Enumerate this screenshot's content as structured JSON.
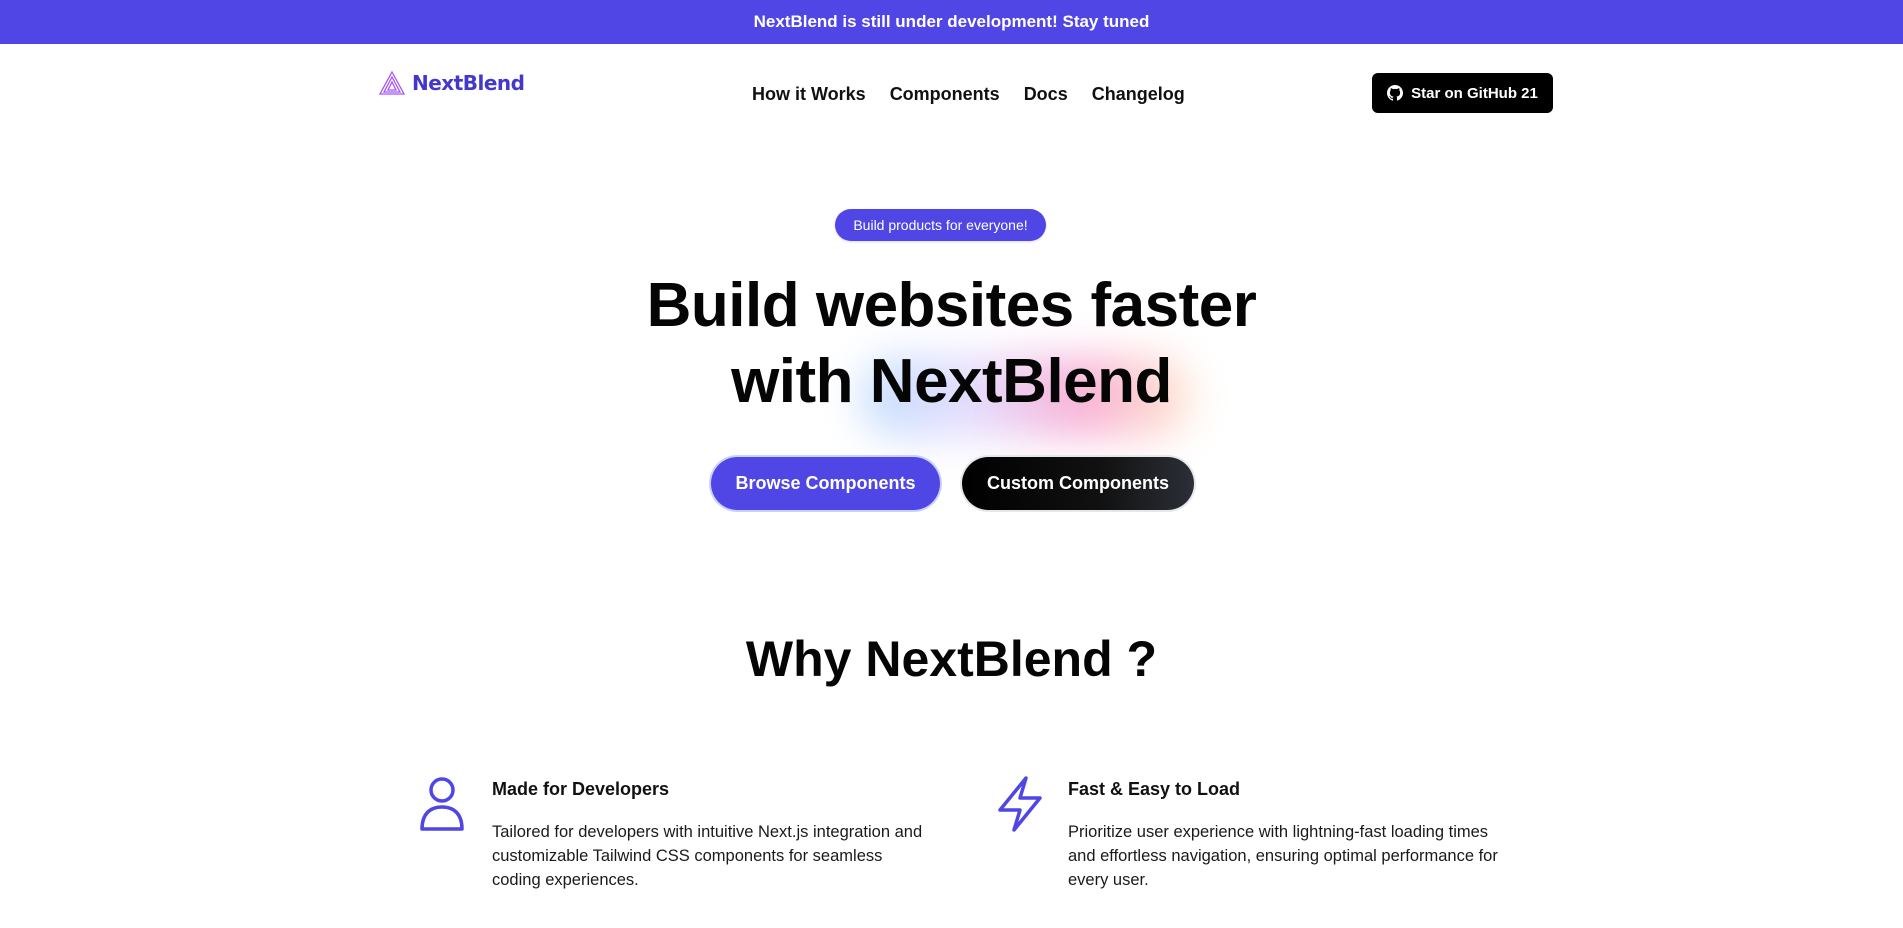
{
  "banner": {
    "text": "NextBlend is still under development! Stay tuned"
  },
  "nav": {
    "logo_text": "NextBlend",
    "links": [
      "How it Works",
      "Components",
      "Docs",
      "Changelog"
    ],
    "github_button": "Star on GitHub 21"
  },
  "hero": {
    "pill": "Build products for everyone!",
    "title_line1": "Build websites faster",
    "title_line2_prefix": "with",
    "title_line2_highlight": "NextBlend",
    "primary_button": "Browse Components",
    "secondary_button": "Custom Components"
  },
  "why": {
    "title": "Why NextBlend ?",
    "features": [
      {
        "icon": "user-icon",
        "title": "Made for Developers",
        "description": "Tailored for developers with intuitive Next.js integration and customizable Tailwind CSS components for seamless coding experiences."
      },
      {
        "icon": "lightning-icon",
        "title": "Fast & Easy to Load",
        "description": "Prioritize user experience with lightning-fast loading times and effortless navigation, ensuring optimal performance for every user."
      }
    ]
  },
  "colors": {
    "accent": "#4f46e5",
    "dark": "#000000",
    "logo": "#4338ca"
  }
}
